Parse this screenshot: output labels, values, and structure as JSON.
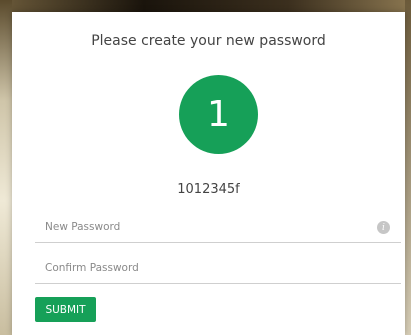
{
  "form": {
    "title": "Please create your new password",
    "avatar_initial": "1",
    "user_id": "1012345f",
    "new_password": {
      "placeholder": "New Password",
      "value": ""
    },
    "confirm_password": {
      "placeholder": "Confirm Password",
      "value": ""
    },
    "submit_label": "SUBMIT",
    "info_glyph": "i"
  },
  "colors": {
    "accent": "#16a058",
    "card_bg": "#ffffff",
    "text": "#444444"
  },
  "icons": {
    "info": "info-icon"
  }
}
